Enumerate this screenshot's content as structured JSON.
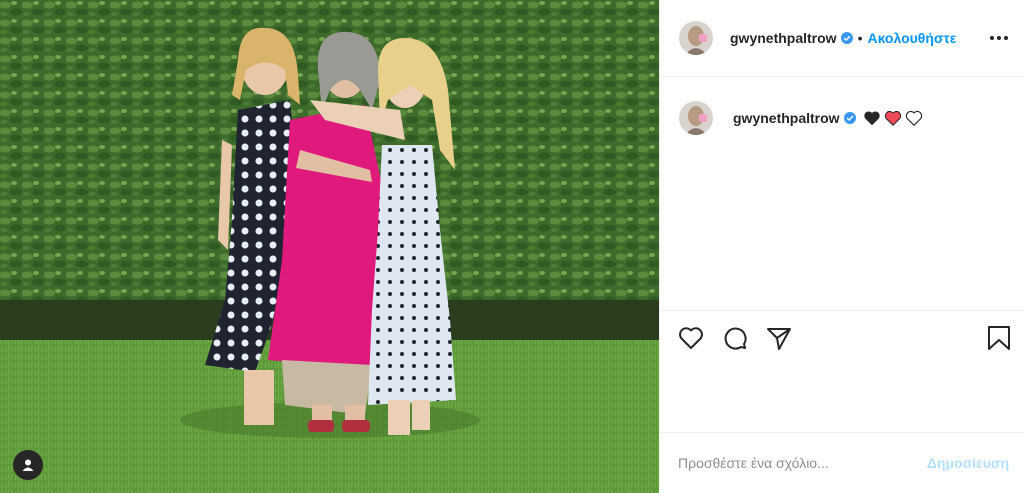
{
  "post": {
    "username": "gwynethpaltrow",
    "separator": "•",
    "follow_label": "Ακολουθήστε",
    "caption_username": "gwynethpaltrow",
    "caption_emoji": [
      "black-heart",
      "red-heart",
      "white-heart"
    ]
  },
  "actions": {
    "icons": [
      "heart-icon",
      "comment-icon",
      "share-icon",
      "bookmark-icon"
    ]
  },
  "comment": {
    "placeholder": "Προσθέστε ένα σχόλιο...",
    "publish_label": "Δημοσίευση"
  },
  "colors": {
    "accent": "#0095f6",
    "accent_disabled": "#b2dffc",
    "red_heart": "#ed4956",
    "verified": "#3897f0"
  }
}
